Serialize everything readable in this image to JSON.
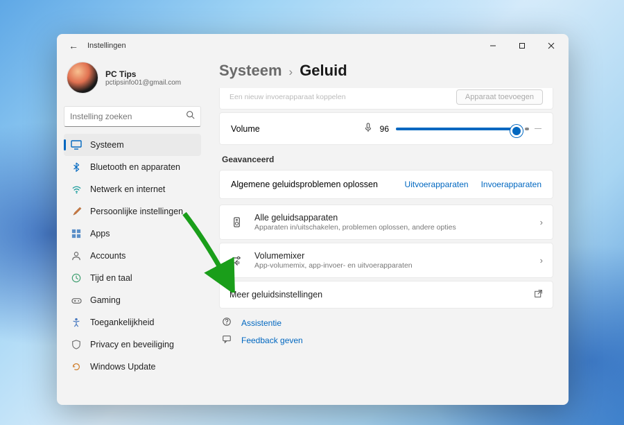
{
  "window": {
    "title": "Instellingen"
  },
  "profile": {
    "name": "PC Tips",
    "email": "pctipsinfo01@gmail.com"
  },
  "search": {
    "placeholder": "Instelling zoeken"
  },
  "nav": {
    "items": [
      {
        "label": "Systeem",
        "icon": "monitor"
      },
      {
        "label": "Bluetooth en apparaten",
        "icon": "bluetooth"
      },
      {
        "label": "Netwerk en internet",
        "icon": "wifi"
      },
      {
        "label": "Persoonlijke instellingen",
        "icon": "brush"
      },
      {
        "label": "Apps",
        "icon": "apps"
      },
      {
        "label": "Accounts",
        "icon": "person"
      },
      {
        "label": "Tijd en taal",
        "icon": "clock"
      },
      {
        "label": "Gaming",
        "icon": "game"
      },
      {
        "label": "Toegankelijkheid",
        "icon": "accessibility"
      },
      {
        "label": "Privacy en beveiliging",
        "icon": "shield"
      },
      {
        "label": "Windows Update",
        "icon": "update"
      }
    ]
  },
  "breadcrumb": {
    "parent": "Systeem",
    "current": "Geluid"
  },
  "clipped_row": {
    "title_fragment": "Een nieuw invoerapparaat koppelen",
    "button": "Apparaat toevoegen"
  },
  "volume": {
    "label": "Volume",
    "value": "96"
  },
  "advanced": {
    "section": "Geavanceerd",
    "troubleshoot": {
      "title": "Algemene geluidsproblemen oplossen",
      "link_out": "Uitvoerapparaten",
      "link_in": "Invoerapparaten"
    },
    "all_devices": {
      "title": "Alle geluidsapparaten",
      "sub": "Apparaten in/uitschakelen, problemen oplossen, andere opties"
    },
    "mixer": {
      "title": "Volumemixer",
      "sub": "App-volumemix, app-invoer- en uitvoerapparaten"
    },
    "more": {
      "title": "Meer geluidsinstellingen"
    }
  },
  "help": {
    "assist": "Assistentie",
    "feedback": "Feedback geven"
  }
}
